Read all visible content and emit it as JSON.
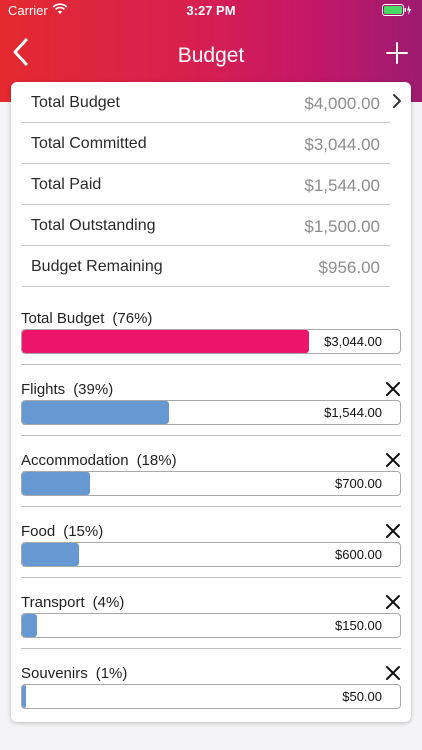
{
  "status": {
    "carrier": "Carrier",
    "time": "3:27 PM"
  },
  "nav": {
    "title": "Budget"
  },
  "summary": [
    {
      "label": "Total Budget",
      "value": "$4,000.00"
    },
    {
      "label": "Total Committed",
      "value": "$3,044.00"
    },
    {
      "label": "Total Paid",
      "value": "$1,544.00"
    },
    {
      "label": "Total Outstanding",
      "value": "$1,500.00"
    },
    {
      "label": "Budget Remaining",
      "value": "$956.00"
    }
  ],
  "total": {
    "name": "Total Budget",
    "pct": "(76%)",
    "amount": "$3,044.00",
    "fill": 0.76,
    "color": "#ec1569"
  },
  "categories": [
    {
      "name": "Flights",
      "pct": "(39%)",
      "amount": "$1,544.00",
      "fill": 0.39
    },
    {
      "name": "Accommodation",
      "pct": "(18%)",
      "amount": "$700.00",
      "fill": 0.18
    },
    {
      "name": "Food",
      "pct": "(15%)",
      "amount": "$600.00",
      "fill": 0.15
    },
    {
      "name": "Transport",
      "pct": "(4%)",
      "amount": "$150.00",
      "fill": 0.04
    },
    {
      "name": "Souvenirs",
      "pct": "(1%)",
      "amount": "$50.00",
      "fill": 0.01
    }
  ],
  "colors": {
    "category_fill": "#6699d1",
    "accent": "#ec1569"
  },
  "icons": {
    "back": "chevron-left-icon",
    "add": "plus-icon",
    "remove": "close-icon",
    "disclosure": "chevron-right-icon"
  }
}
